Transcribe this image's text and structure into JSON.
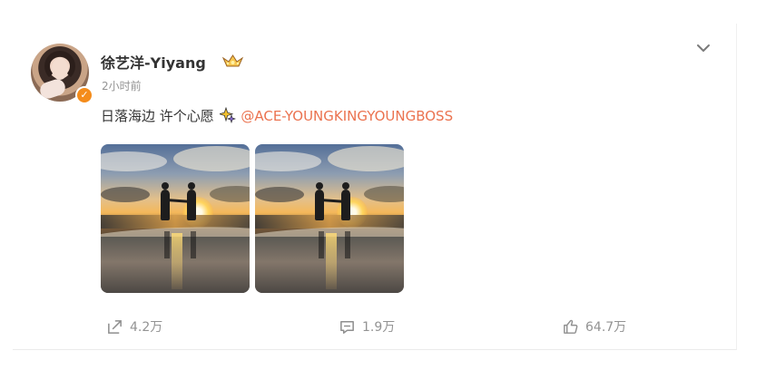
{
  "post": {
    "username": "徐艺洋-Yiyang",
    "time": "2小时前",
    "text_prefix": "日落海边 许个心愿",
    "mention": "@ACE-YOUNGKINGYOUNGBOSS"
  },
  "photos": [
    {
      "alt": "sunset beach couple photo"
    },
    {
      "alt": "sunset beach couple photo"
    }
  ],
  "actions": {
    "forward_count": "4.2万",
    "comment_count": "1.9万",
    "like_count": "64.7万"
  },
  "colors": {
    "mention": "#eb7350",
    "secondary_text": "#939393",
    "verified_badge": "#f48c1b"
  },
  "icons": {
    "crown": "crown-icon",
    "sparkle": "sparkle-icon",
    "chevron": "chevron-down-icon",
    "forward": "share-icon",
    "comment": "comment-icon",
    "like": "like-icon"
  }
}
